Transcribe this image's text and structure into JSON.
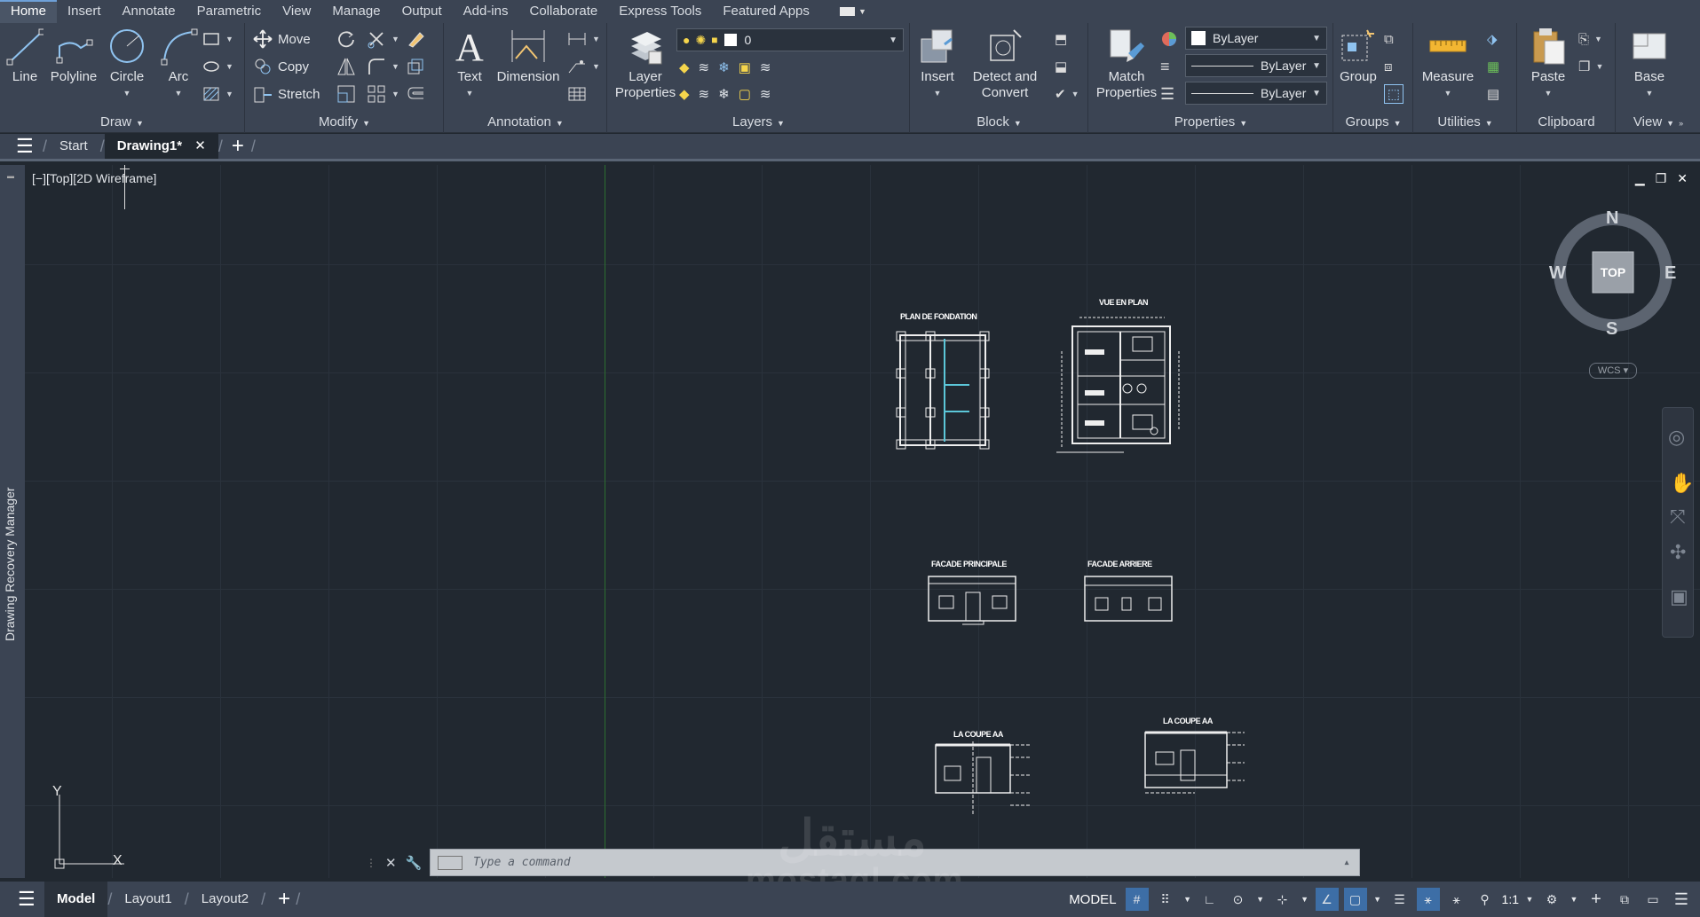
{
  "menu": {
    "tabs": [
      "Home",
      "Insert",
      "Annotate",
      "Parametric",
      "View",
      "Manage",
      "Output",
      "Add-ins",
      "Collaborate",
      "Express Tools",
      "Featured Apps"
    ],
    "active": "Home"
  },
  "ribbon": {
    "draw": {
      "title": "Draw",
      "line": "Line",
      "polyline": "Polyline",
      "circle": "Circle",
      "arc": "Arc"
    },
    "modify": {
      "title": "Modify",
      "move": "Move",
      "copy": "Copy",
      "stretch": "Stretch"
    },
    "annotation": {
      "title": "Annotation",
      "text": "Text",
      "dimension": "Dimension"
    },
    "layers": {
      "title": "Layers",
      "layer_properties_1": "Layer",
      "layer_properties_2": "Properties",
      "current_layer": "0"
    },
    "block": {
      "title": "Block",
      "insert": "Insert",
      "detect_1": "Detect and",
      "detect_2": "Convert"
    },
    "properties": {
      "title": "Properties",
      "match_1": "Match",
      "match_2": "Properties",
      "color": "ByLayer",
      "linetype": "ByLayer",
      "lineweight": "ByLayer"
    },
    "groups": {
      "title": "Groups",
      "group": "Group"
    },
    "utilities": {
      "title": "Utilities",
      "measure": "Measure"
    },
    "clipboard": {
      "title": "Clipboard",
      "paste": "Paste"
    },
    "view": {
      "title": "View",
      "base": "Base"
    }
  },
  "filetabs": {
    "start": "Start",
    "drawing": "Drawing1*"
  },
  "viewport": {
    "label": "[−][Top][2D Wireframe]",
    "sidebar": "Drawing Recovery Manager",
    "sheets": {
      "plan_fondation": "PLAN DE FONDATION",
      "vue_en_plan": "VUE EN PLAN",
      "facade_principale": "FACADE PRINCIPALE",
      "facade_arriere": "FACADE ARRIERE",
      "coupe_1": "LA COUPE AA",
      "coupe_2": "LA COUPE AA"
    },
    "compass": {
      "n": "N",
      "s": "S",
      "e": "E",
      "w": "W",
      "center": "TOP",
      "wcs": "WCS"
    },
    "ucs": {
      "x": "X",
      "y": "Y"
    }
  },
  "command": {
    "placeholder": "Type a command"
  },
  "statusbar": {
    "model": "Model",
    "layout1": "Layout1",
    "layout2": "Layout2",
    "model_space": "MODEL",
    "scale": "1:1"
  },
  "watermark": {
    "arabic": "مستقل",
    "latin": "mostaql.com"
  }
}
